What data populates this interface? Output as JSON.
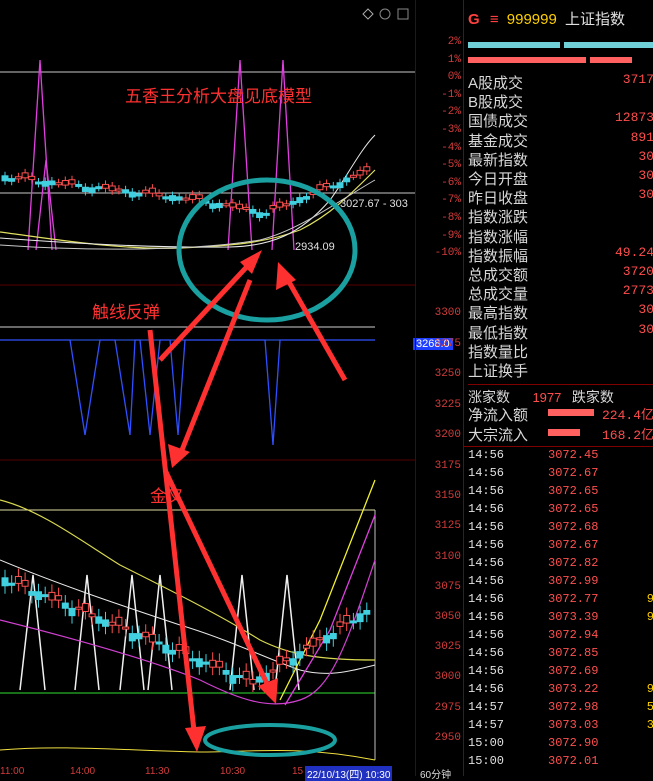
{
  "header": {
    "g": "G",
    "menu_glyph": "≡",
    "code": "999999",
    "name": "上证指数"
  },
  "annotations": {
    "title": "五香王分析大盘见底模型",
    "touch": "触线反弹",
    "cross": "金叉"
  },
  "chart_labels": {
    "top_price": "3027.67 - 303",
    "low_price": "2934.09",
    "price_box": "3268.0",
    "bottom_tab": "60分钟",
    "times": [
      "11:00",
      "14:00",
      "11:30",
      "10:30",
      "15",
      "22/10/13(四) 10:30"
    ]
  },
  "axis_pct": [
    "2%",
    "1%",
    "0%",
    "-1%",
    "-2%",
    "-3%",
    "-4%",
    "-5%",
    "-6%",
    "-7%",
    "-8%",
    "-9%",
    "-10%"
  ],
  "axis_mid": [
    "3300",
    "3275",
    "3250",
    "3225",
    "3200"
  ],
  "axis_low": [
    "3175",
    "3150",
    "3125",
    "3100",
    "3075",
    "3050",
    "3025",
    "3000",
    "2975",
    "2950"
  ],
  "stats": [
    {
      "k": "A股成交",
      "v": "3717"
    },
    {
      "k": "B股成交",
      "v": ""
    },
    {
      "k": "国债成交",
      "v": "12873"
    },
    {
      "k": "基金成交",
      "v": "891"
    },
    {
      "k": "最新指数",
      "v": "30"
    },
    {
      "k": "今日开盘",
      "v": "30"
    },
    {
      "k": "昨日收盘",
      "v": "30"
    },
    {
      "k": "指数涨跌",
      "v": ""
    },
    {
      "k": "指数涨幅",
      "v": ""
    },
    {
      "k": "指数振幅",
      "v": "49.24"
    },
    {
      "k": "总成交额",
      "v": "3720"
    },
    {
      "k": "总成交量",
      "v": "2773"
    },
    {
      "k": "最高指数",
      "v": "30"
    },
    {
      "k": "最低指数",
      "v": "30"
    },
    {
      "k": "指数量比",
      "v": ""
    },
    {
      "k": "上证换手",
      "v": ""
    }
  ],
  "breadth": {
    "up_label": "涨家数",
    "up": "1977",
    "down_label": "跌家数"
  },
  "flows": [
    {
      "k": "净流入额",
      "v": "224.4亿"
    },
    {
      "k": "大宗流入",
      "v": "168.2亿"
    }
  ],
  "ticks": [
    {
      "t": "14:56",
      "p": "3072.45",
      "s": ""
    },
    {
      "t": "14:56",
      "p": "3072.67",
      "s": ""
    },
    {
      "t": "14:56",
      "p": "3072.65",
      "s": ""
    },
    {
      "t": "14:56",
      "p": "3072.65",
      "s": ""
    },
    {
      "t": "14:56",
      "p": "3072.68",
      "s": ""
    },
    {
      "t": "14:56",
      "p": "3072.67",
      "s": ""
    },
    {
      "t": "14:56",
      "p": "3072.82",
      "s": ""
    },
    {
      "t": "14:56",
      "p": "3072.99",
      "s": ""
    },
    {
      "t": "14:56",
      "p": "3072.77",
      "s": "9"
    },
    {
      "t": "14:56",
      "p": "3073.39",
      "s": "9"
    },
    {
      "t": "14:56",
      "p": "3072.94",
      "s": ""
    },
    {
      "t": "14:56",
      "p": "3072.85",
      "s": ""
    },
    {
      "t": "14:56",
      "p": "3072.69",
      "s": ""
    },
    {
      "t": "14:56",
      "p": "3073.22",
      "s": "9"
    },
    {
      "t": "14:57",
      "p": "3072.98",
      "s": "5"
    },
    {
      "t": "14:57",
      "p": "3073.03",
      "s": "3"
    },
    {
      "t": "15:00",
      "p": "3072.90",
      "s": ""
    },
    {
      "t": "15:00",
      "p": "3072.01",
      "s": ""
    }
  ]
}
